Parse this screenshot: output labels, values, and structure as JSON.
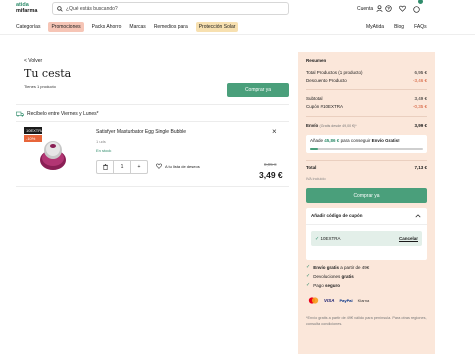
{
  "header": {
    "logo_line1": "atida",
    "logo_line2": "mifarma",
    "search_placeholder": "¿Qué estás buscando?",
    "account_label": "Cuenta"
  },
  "nav": {
    "left": [
      "Categorías",
      "Promociones",
      "Packs Ahorro",
      "Marcas",
      "Remedios para",
      "Protección Solar"
    ],
    "right": [
      "MyAtida",
      "Blog",
      "FAQs"
    ]
  },
  "cart": {
    "back": "< Volver",
    "title": "Tu cesta",
    "count": "Tienes 1 producto",
    "buy_label": "Comprar ya",
    "shipping": "Recíbelo entre Viernes y Lunes*"
  },
  "product": {
    "badges": [
      "10EXTRA",
      "-10%"
    ],
    "name": "Satisfyer Masturbator Egg Single Bubble",
    "category": "1 uds",
    "stock": "En stock",
    "quantity": "1",
    "minus": "−",
    "plus": "+",
    "wishlist": "A tu lista de deseos",
    "old_price": "8,95 €",
    "new_price": "3,49 €",
    "remove": "×"
  },
  "summary": {
    "title": "Resumen",
    "rows1": [
      {
        "label": "Total Productos (1 producto)",
        "value": "6,95 €",
        "red": false
      },
      {
        "label": "Descuento Producto",
        "value": "-3,46 €",
        "red": true
      }
    ],
    "rows2": [
      {
        "label": "Subtotal",
        "value": "3,49 €",
        "red": false
      },
      {
        "label": "Cupón #10EXTRA",
        "value": "-0,35 €",
        "red": true
      }
    ],
    "envio_label": "Envío",
    "envio_note": "(Gratis desde 49,00 €)*",
    "envio_value": "3,99 €",
    "envio_add_pre": "Añade",
    "envio_add_amount": "45,86 €",
    "envio_add_post": "para conseguir",
    "envio_add_bold": "Envío Gratis!",
    "envio_progress": 0.07,
    "total_label": "Total",
    "total_value": "7,13 €",
    "iva": "IVA incluido",
    "buy_label": "Comprar ya",
    "coupon_title": "Añadir código de cupón",
    "coupon_code": "10EXTRA",
    "coupon_cancel": "Cancelar",
    "benefits": [
      {
        "bold": "Envío gratis",
        "rest": " a partir de 49€"
      },
      {
        "bold": "",
        "rest": "Devoluciones "
      },
      {
        "bold": "",
        "rest": "Pago "
      }
    ],
    "benefit2_bold": "gratis",
    "benefit3_bold": "seguro",
    "payments": [
      "mastercard-icon",
      "VISA",
      "PayPal",
      "Klarna"
    ],
    "footnote": "*Envío gratis a partir de 49€ válido para península. Para otras regiones, consulta condiciones."
  },
  "colors": {
    "brand": "#2f8c6b",
    "button": "#4a9f7b",
    "panel": "#fbe7da",
    "discount": "#d2542f"
  }
}
